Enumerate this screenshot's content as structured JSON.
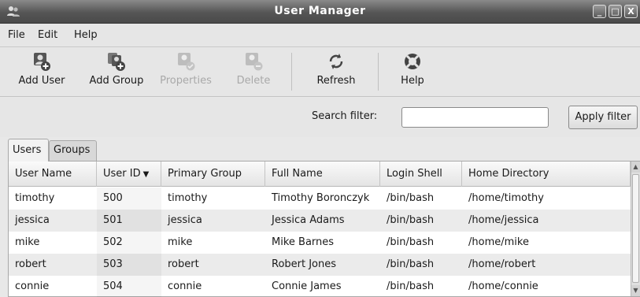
{
  "window": {
    "title": "User Manager",
    "controls": {
      "minimize": "_",
      "maximize": "□",
      "close": "X"
    }
  },
  "menu": [
    {
      "label": "File"
    },
    {
      "label": "Edit"
    },
    {
      "label": "Help"
    }
  ],
  "toolbar": {
    "add_user": "Add User",
    "add_group": "Add Group",
    "properties": "Properties",
    "delete": "Delete",
    "refresh": "Refresh",
    "help": "Help"
  },
  "filter": {
    "label": "Search filter:",
    "value": "",
    "apply": "Apply filter"
  },
  "tabs": [
    {
      "label": "Users",
      "active": true
    },
    {
      "label": "Groups",
      "active": false
    }
  ],
  "table": {
    "sort_indicator": "▼",
    "columns": [
      "User Name",
      "User ID",
      "Primary Group",
      "Full Name",
      "Login Shell",
      "Home Directory"
    ],
    "rows": [
      [
        "timothy",
        "500",
        "timothy",
        "Timothy Boronczyk",
        "/bin/bash",
        "/home/timothy"
      ],
      [
        "jessica",
        "501",
        "jessica",
        "Jessica Adams",
        "/bin/bash",
        "/home/jessica"
      ],
      [
        "mike",
        "502",
        "mike",
        "Mike Barnes",
        "/bin/bash",
        "/home/mike"
      ],
      [
        "robert",
        "503",
        "robert",
        "Robert Jones",
        "/bin/bash",
        "/home/robert"
      ],
      [
        "connie",
        "504",
        "connie",
        "Connie James",
        "/bin/bash",
        "/home/connie"
      ]
    ]
  },
  "colors": {
    "titlebar": "#555555",
    "background": "#e6e6e6",
    "row_alt": "#ebebeb"
  }
}
